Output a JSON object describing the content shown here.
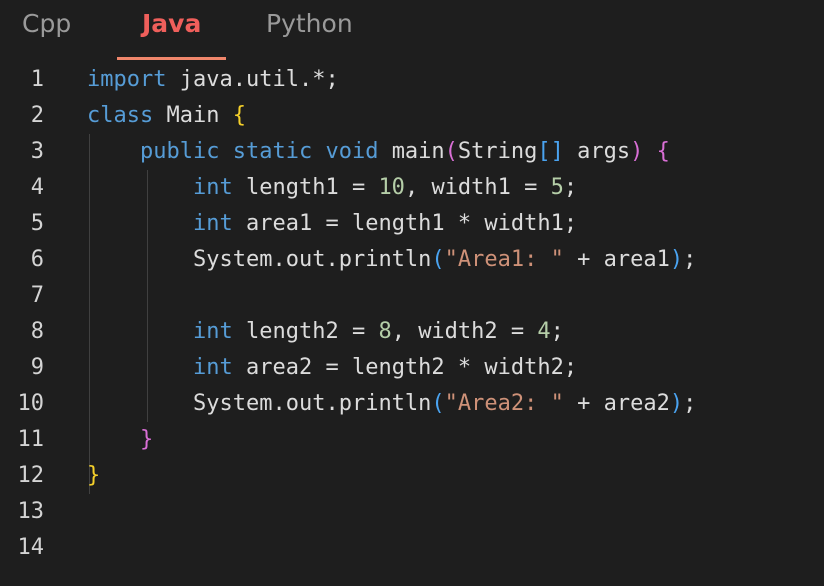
{
  "tabs": [
    {
      "label": "Cpp",
      "active": false
    },
    {
      "label": "Java",
      "active": true
    },
    {
      "label": "Python",
      "active": false
    }
  ],
  "colors": {
    "background": "#1e1e1e",
    "active_tab": "#ef5f5b",
    "tab_underline": "#f0866b",
    "inactive_tab": "#9a9a9a",
    "keyword": "#569cd6",
    "number": "#b5cea8",
    "string": "#ce9178",
    "bracket_level1": "#f5d02a",
    "bracket_level2": "#d96fd6",
    "bracket_level3": "#4aa3f0"
  },
  "editor": {
    "language": "Java",
    "lines": [
      {
        "n": "1",
        "text": "import java.util.*;"
      },
      {
        "n": "2",
        "text": "class Main {"
      },
      {
        "n": "3",
        "text": "    public static void main(String[] args) {"
      },
      {
        "n": "4",
        "text": "        int length1 = 10, width1 = 5;"
      },
      {
        "n": "5",
        "text": "        int area1 = length1 * width1;"
      },
      {
        "n": "6",
        "text": "        System.out.println(\"Area1: \" + area1);"
      },
      {
        "n": "7",
        "text": ""
      },
      {
        "n": "8",
        "text": "        int length2 = 8, width2 = 4;"
      },
      {
        "n": "9",
        "text": "        int area2 = length2 * width2;"
      },
      {
        "n": "10",
        "text": "        System.out.println(\"Area2: \" + area2);"
      },
      {
        "n": "11",
        "text": "    }"
      },
      {
        "n": "12",
        "text": "}"
      },
      {
        "n": "13",
        "text": ""
      },
      {
        "n": "14",
        "text": ""
      }
    ]
  }
}
